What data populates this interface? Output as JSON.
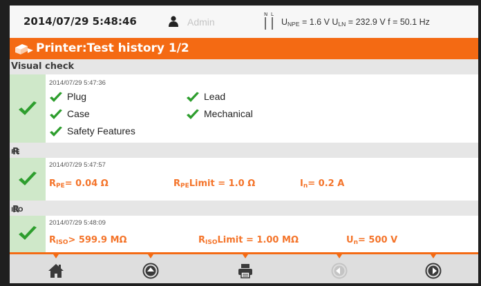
{
  "status": {
    "datetime": "2014/07/29 5:48:46",
    "user": "Admin",
    "phase_labels": [
      "N",
      "L"
    ],
    "measurements": [
      {
        "label": "U",
        "sub": "NPE",
        "value": " = 1.6 V "
      },
      {
        "label": "U",
        "sub": "LN",
        "value": " = 232.9 V f = 50.1 Hz"
      }
    ]
  },
  "title": "Printer:Test history 1/2",
  "sections": {
    "visual": {
      "header": "Visual check",
      "timestamp": "2014/07/29 5:47:36",
      "items": [
        "Plug",
        "Lead",
        "Case",
        "Mechanical",
        "Safety Features"
      ]
    },
    "rpe": {
      "header_main": "R",
      "header_sub": "PE",
      "timestamp": "2014/07/29 5:47:57",
      "results": [
        {
          "main": "R",
          "sub": "PE",
          "text": "= 0.04 Ω"
        },
        {
          "main": "R",
          "sub": "PE",
          "text": "Limit = 1.0 Ω"
        },
        {
          "main": "I",
          "sub": "n",
          "text": "= 0.2 A"
        }
      ]
    },
    "riso": {
      "header_main": "R",
      "header_sub": "ISO",
      "timestamp": "2014/07/29 5:48:09",
      "results": [
        {
          "main": "R",
          "sub": "ISO",
          "text": "> 599.9 MΩ"
        },
        {
          "main": "R",
          "sub": "ISO",
          "text": "Limit = 1.00 MΩ"
        },
        {
          "main": "U",
          "sub": "n",
          "text": "= 500 V"
        }
      ]
    }
  },
  "nav": {
    "buttons": [
      {
        "icon": "home-icon",
        "enabled": true
      },
      {
        "icon": "arrow-up-circle-icon",
        "enabled": true
      },
      {
        "icon": "printer-icon",
        "enabled": true
      },
      {
        "icon": "arrow-left-circle-icon",
        "enabled": false
      },
      {
        "icon": "arrow-right-circle-icon",
        "enabled": true
      }
    ]
  },
  "colors": {
    "accent": "#f46a13",
    "result_text": "#f4742a",
    "check_green": "#2e9e2e",
    "check_cell": "#cfe8c9"
  }
}
